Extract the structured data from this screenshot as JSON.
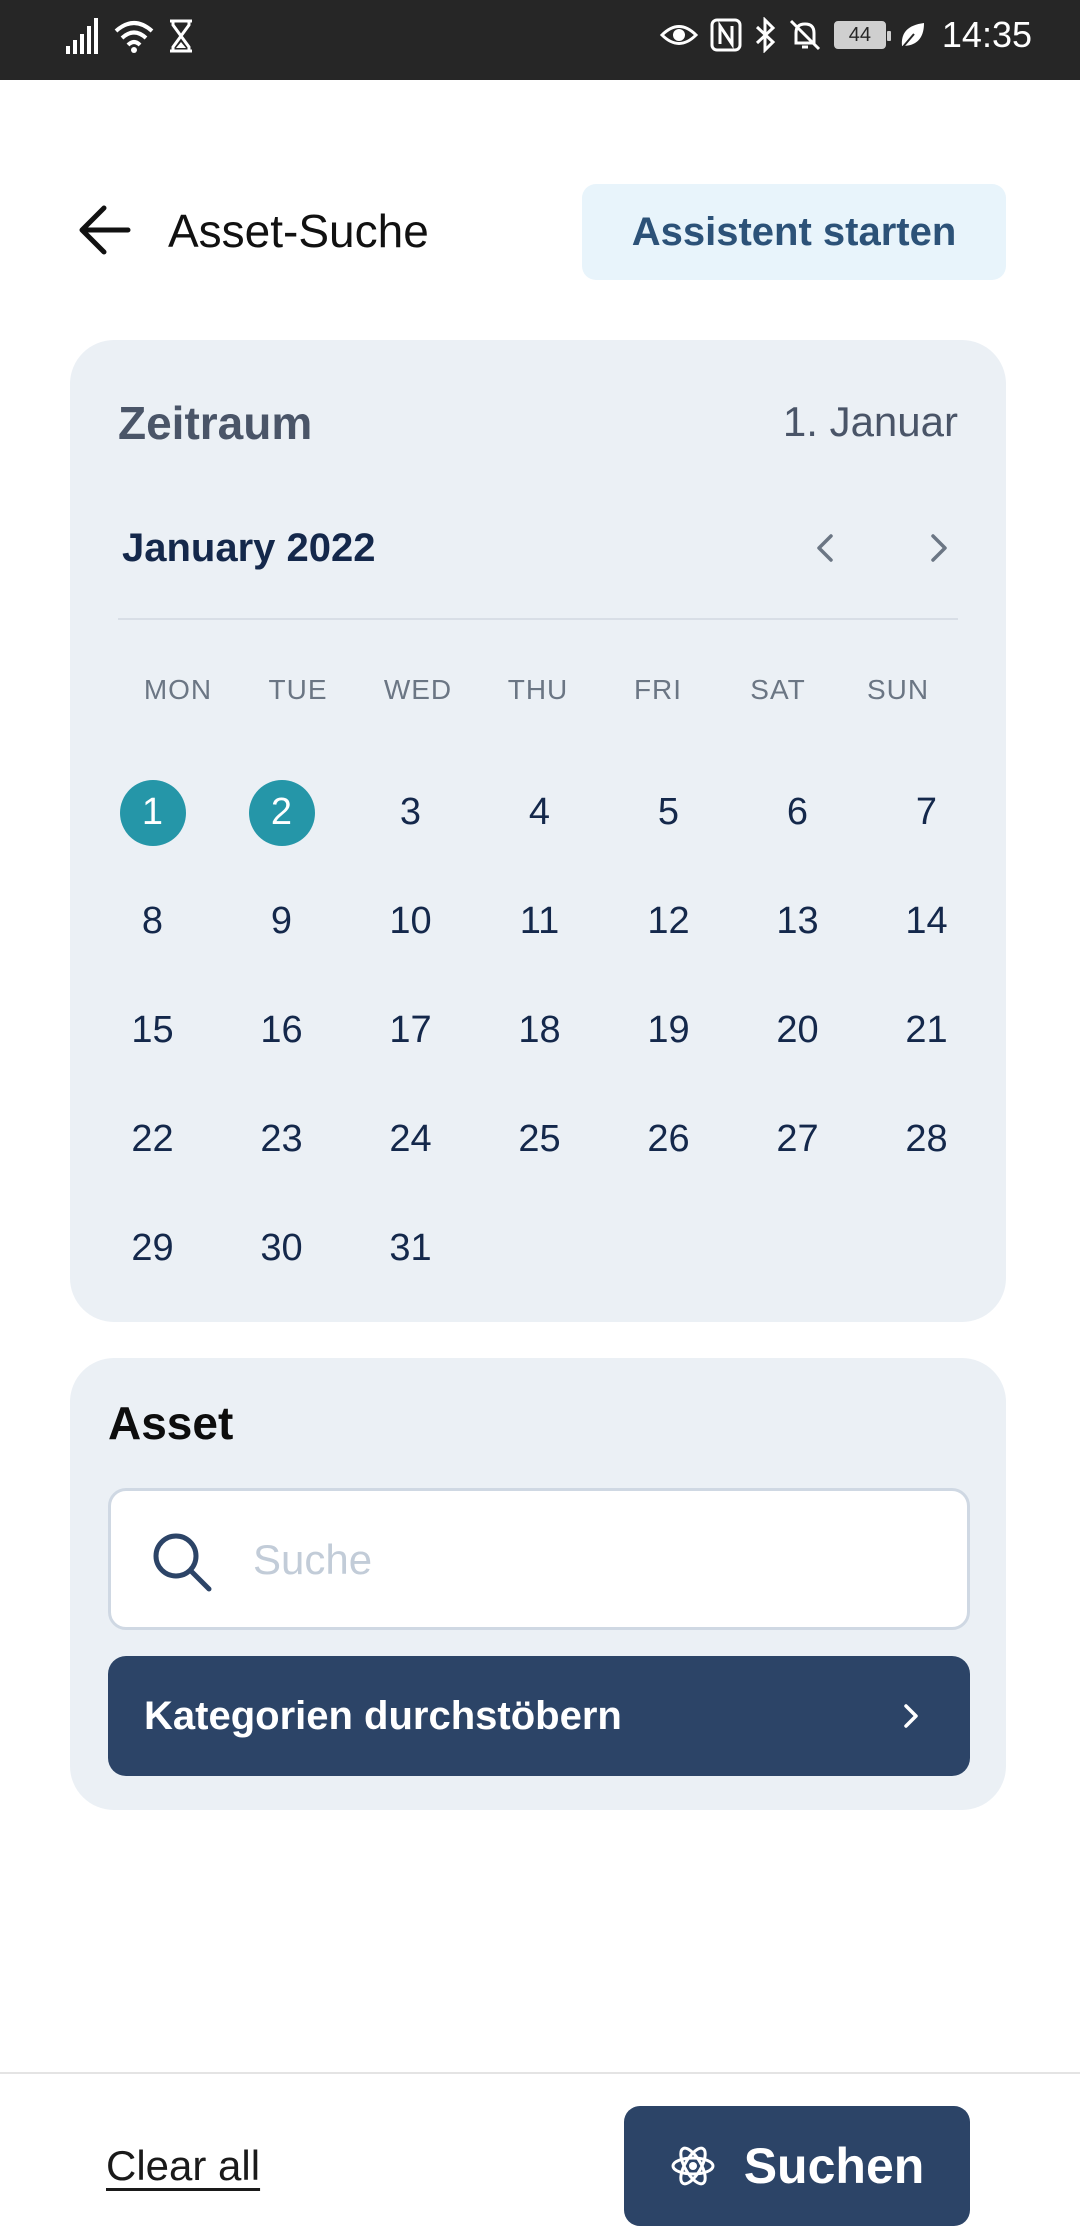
{
  "status_bar": {
    "time": "14:35",
    "battery_level": "44",
    "icons": [
      "signal-icon",
      "wifi-icon",
      "hourglass-icon",
      "eye-icon",
      "nfc-icon",
      "bluetooth-icon",
      "bell-off-icon",
      "battery-icon",
      "leaf-icon"
    ]
  },
  "header": {
    "title": "Asset-Suche",
    "assistant_label": "Assistent starten"
  },
  "date_card": {
    "title": "Zeitraum",
    "selected_date": "1. Januar",
    "month_label": "January 2022",
    "weekdays": [
      "MON",
      "TUE",
      "WED",
      "THU",
      "FRI",
      "SAT",
      "SUN"
    ],
    "days": [
      "1",
      "2",
      "3",
      "4",
      "5",
      "6",
      "7",
      "8",
      "9",
      "10",
      "11",
      "12",
      "13",
      "14",
      "15",
      "16",
      "17",
      "18",
      "19",
      "20",
      "21",
      "22",
      "23",
      "24",
      "25",
      "26",
      "27",
      "28",
      "29",
      "30",
      "31"
    ],
    "selected_days": [
      "1",
      "2"
    ]
  },
  "asset_card": {
    "title": "Asset",
    "search_placeholder": "Suche",
    "search_value": "",
    "category_label": "Kategorien durchstöbern"
  },
  "footer": {
    "clear_label": "Clear all",
    "search_label": "Suchen"
  },
  "colors": {
    "accent": "#2596a8",
    "primary": "#2c4467",
    "card_bg": "#ebf0f5"
  }
}
